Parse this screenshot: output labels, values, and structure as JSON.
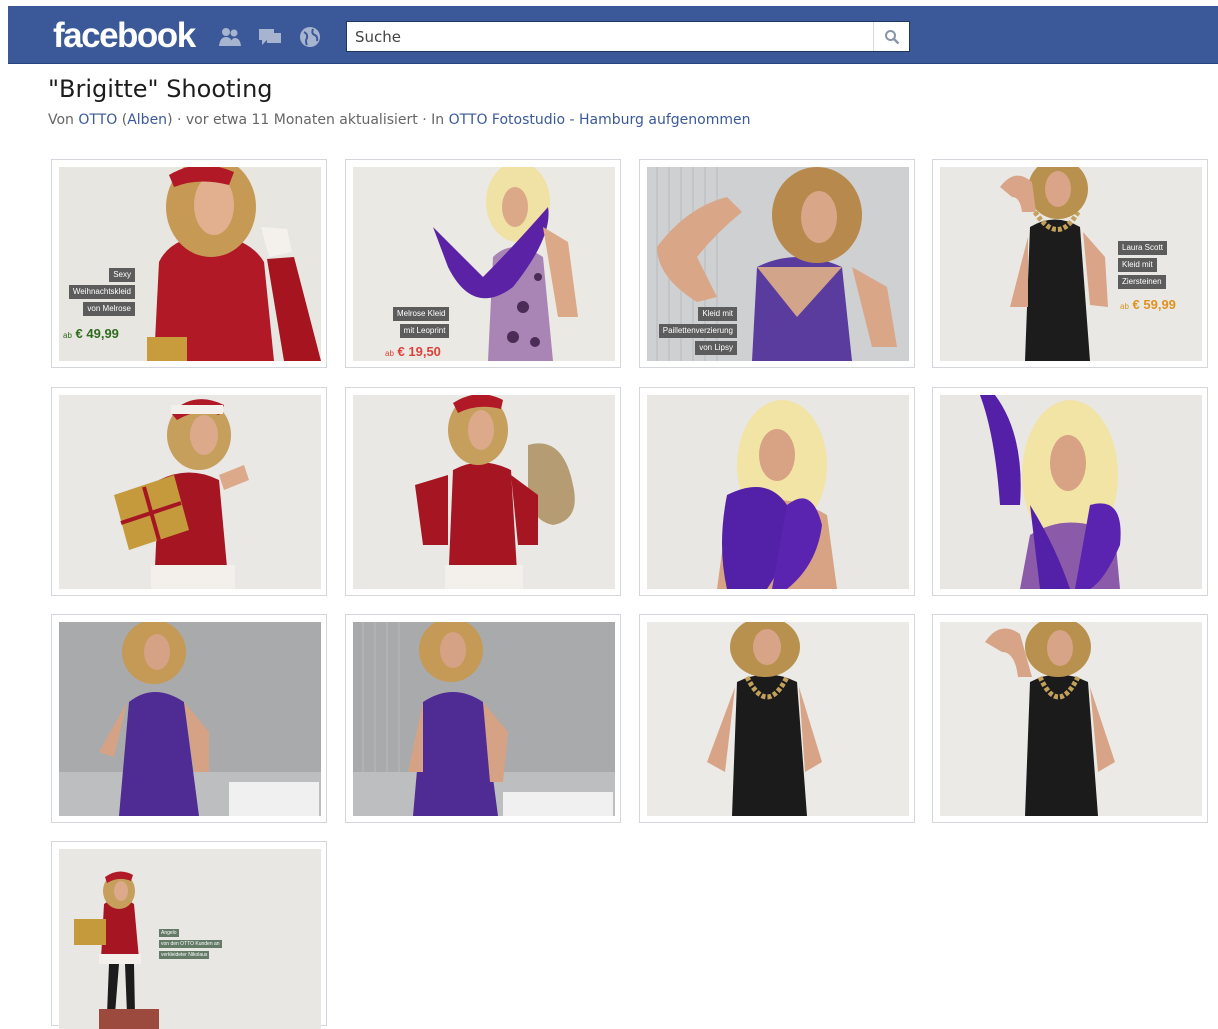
{
  "header": {
    "logo": "facebook",
    "search_placeholder": "Suche",
    "icons": [
      "friends-icon",
      "messages-icon",
      "notifications-globe-icon",
      "search-icon"
    ],
    "brand_color": "#3b5998"
  },
  "album": {
    "title": "\"Brigitte\" Shooting",
    "meta_prefix": "Von ",
    "owner": "OTTO",
    "albums_link": "Alben",
    "meta_middle": " · vor etwa 11 Monaten aktualisiert · In ",
    "location": "OTTO Fotostudio - Hamburg aufgenommen"
  },
  "photos": [
    {
      "label": "red-santa-dress-gift",
      "tags": [
        "Sexy",
        "Weihnachtskleid",
        "von Melrose"
      ],
      "price": "€ 49,99",
      "price_prefix": "ab",
      "price_color": "#2e6b1e"
    },
    {
      "label": "leopard-dress-purple-boa",
      "tags": [
        "Melrose Kleid",
        "mit Leoprint"
      ],
      "price": "€ 19,50",
      "price_prefix": "ab",
      "price_color": "#d8433a"
    },
    {
      "label": "purple-sequin-dress-closeup",
      "tags": [
        "Kleid mit",
        "Paillettenverzierung",
        "von Lipsy"
      ]
    },
    {
      "label": "black-dress-necklace",
      "tags": [
        "Laura Scott",
        "Kleid mit",
        "Ziersteinen"
      ],
      "price": "€ 59,99",
      "price_prefix": "ab",
      "price_color": "#e0921e"
    },
    {
      "label": "santa-dress-gift-kiss"
    },
    {
      "label": "santa-dress-sack"
    },
    {
      "label": "blonde-wig-purple-boa"
    },
    {
      "label": "blonde-wig-boa-raised"
    },
    {
      "label": "purple-dress-full"
    },
    {
      "label": "purple-dress-standing"
    },
    {
      "label": "black-dress-full"
    },
    {
      "label": "black-dress-arm-raised"
    },
    {
      "label": "santa-full-body-gifts",
      "tags": [
        "Angelo",
        "von den OTTO Kunden an",
        "verkleideter Nikolaus"
      ]
    }
  ]
}
